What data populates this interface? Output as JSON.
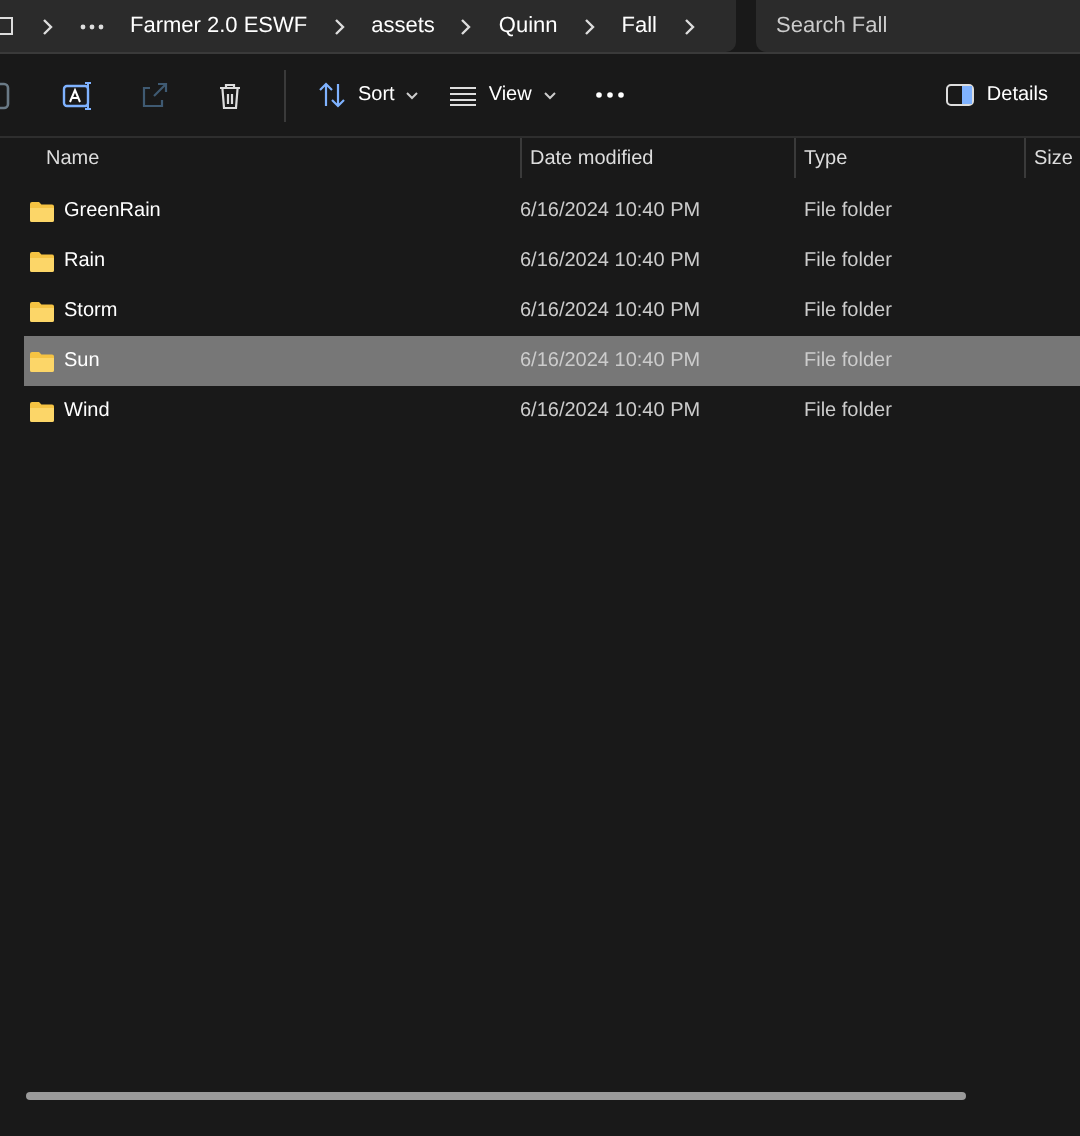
{
  "breadcrumb": [
    "Farmer 2.0 ESWF",
    "assets",
    "Quinn",
    "Fall"
  ],
  "search": {
    "placeholder": "Search Fall"
  },
  "toolbar": {
    "sort": "Sort",
    "view": "View",
    "details": "Details",
    "share_disabled": true
  },
  "columns": [
    "Name",
    "Date modified",
    "Type",
    "Size"
  ],
  "rows": [
    {
      "name": "GreenRain",
      "date": "6/16/2024 10:40 PM",
      "type": "File folder",
      "selected": false
    },
    {
      "name": "Rain",
      "date": "6/16/2024 10:40 PM",
      "type": "File folder",
      "selected": false
    },
    {
      "name": "Storm",
      "date": "6/16/2024 10:40 PM",
      "type": "File folder",
      "selected": false
    },
    {
      "name": "Sun",
      "date": "6/16/2024 10:40 PM",
      "type": "File folder",
      "selected": true
    },
    {
      "name": "Wind",
      "date": "6/16/2024 10:40 PM",
      "type": "File folder",
      "selected": false
    }
  ]
}
